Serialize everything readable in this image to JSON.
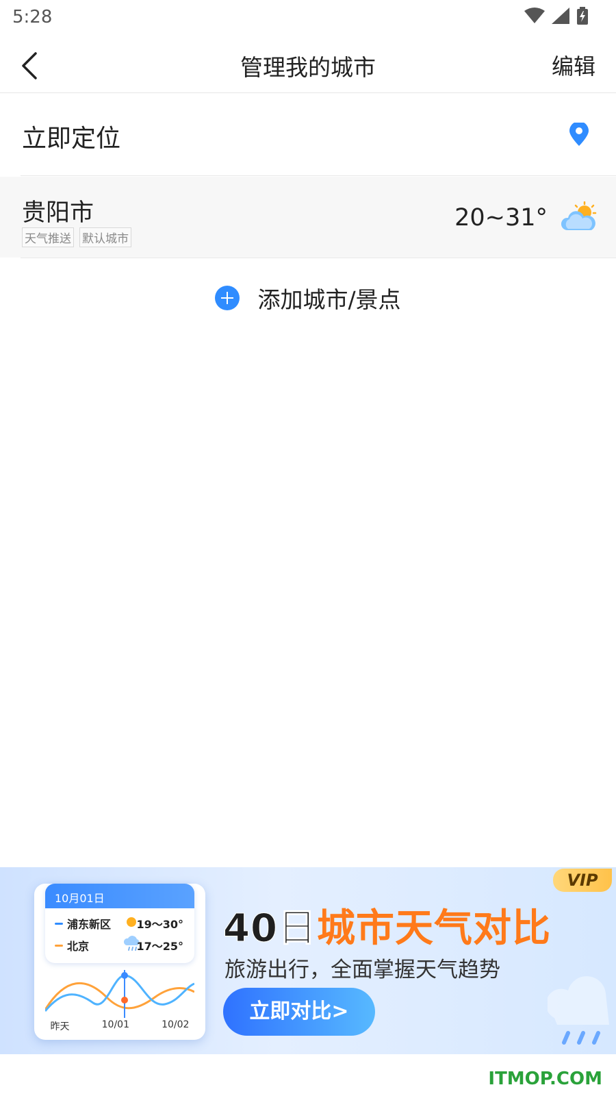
{
  "status_bar": {
    "time": "5:28"
  },
  "header": {
    "title": "管理我的城市",
    "edit_label": "编辑"
  },
  "locate": {
    "label": "立即定位",
    "icon": "location-pin-icon",
    "accent": "#2f8cff"
  },
  "city": {
    "name": "贵阳市",
    "tags": [
      "天气推送",
      "默认城市"
    ],
    "temp_range": "20~31°",
    "weather_icon": "partly-cloudy-icon"
  },
  "add": {
    "label": "添加城市/景点"
  },
  "banner": {
    "vip": "VIP",
    "card_date": "10月01日",
    "card_rows": [
      {
        "name": "浦东新区",
        "temp": "19～30°",
        "color": "#2f8cff",
        "icon": "sun-icon"
      },
      {
        "name": "北京",
        "temp": "17～25°",
        "color": "#ffa23a",
        "icon": "rain-icon"
      }
    ],
    "card_xlabels": [
      "昨天",
      "10/01",
      "10/02"
    ],
    "title_dark": "40日",
    "title_accent": "城市天气对比",
    "subtitle": "旅游出行，全面掌握天气趋势",
    "cta": "立即对比>"
  },
  "watermark": "ITMOP.COM"
}
